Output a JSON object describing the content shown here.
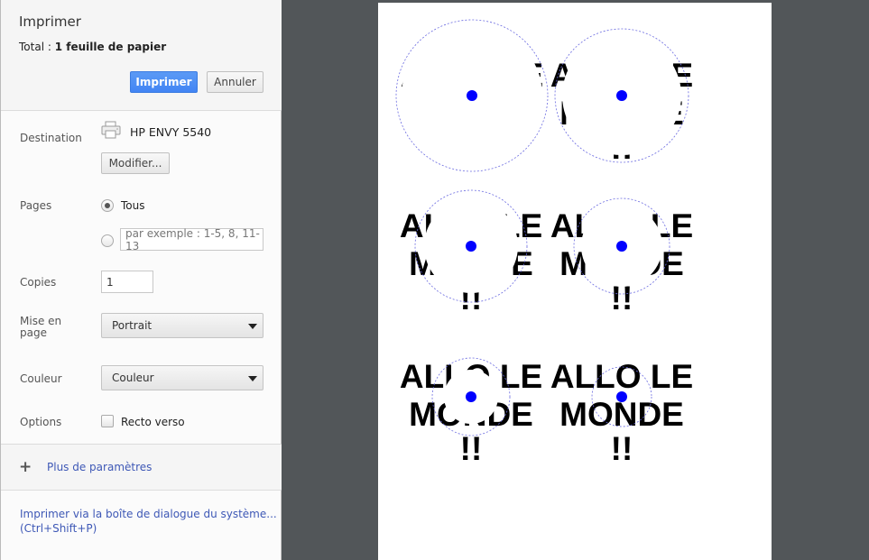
{
  "dialog": {
    "title": "Imprimer",
    "total_label": "Total :",
    "total_value": "1 feuille de papier",
    "print_button": "Imprimer",
    "cancel_button": "Annuler"
  },
  "destination": {
    "label": "Destination",
    "printer_name": "HP ENVY 5540",
    "icon": "printer-icon",
    "change_button": "Modifier..."
  },
  "pages": {
    "label": "Pages",
    "all_option": "Tous",
    "all_selected": true,
    "range_placeholder": "par exemple : 1-5, 8, 11-13"
  },
  "copies": {
    "label": "Copies",
    "value": "1"
  },
  "layout": {
    "label_line1": "Mise en",
    "label_line2": "page",
    "value": "Portrait"
  },
  "color": {
    "label": "Couleur",
    "value": "Couleur"
  },
  "options": {
    "label": "Options",
    "duplex_label": "Recto verso",
    "duplex_checked": false
  },
  "more_settings": {
    "icon": "plus-icon",
    "label": "Plus de paramètres"
  },
  "system_dialog": {
    "line1": "Imprimer via la boîte de dialogue du système...",
    "line2": "(Ctrl+Shift+P)"
  },
  "preview": {
    "text_lines": [
      "ALLO LE",
      "MONDE",
      "!!"
    ],
    "dot_color": "#0000ff",
    "circle_color": "#6a6ae0"
  }
}
